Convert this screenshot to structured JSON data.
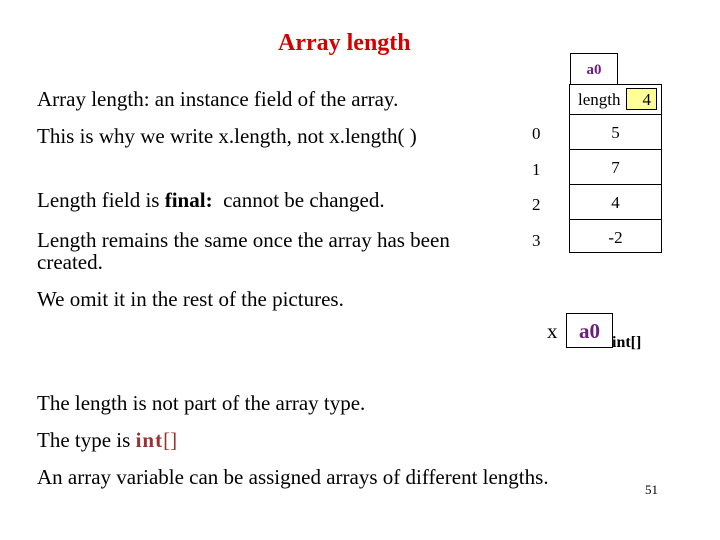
{
  "slide": {
    "title": "Array length",
    "page_number": "51",
    "colors": {
      "title": "#d40000",
      "object_name": "#6b1f7a",
      "length_box": "#ffff99",
      "type_highlight": "#993333"
    }
  },
  "text": {
    "line1": "Array length: an instance field of the array.",
    "line2": "This is why we write x.length, not x.length( )",
    "line3_prefix": "Length field is ",
    "line3_bold": "final:",
    "line3_suffix": "  cannot be changed.",
    "line4a": "Length remains the same once the array has been",
    "line4b": "created.",
    "line5": "We omit it in the rest of the pictures.",
    "line6": "The length is not part of the array type.",
    "line7_prefix": "The type is ",
    "line7_type": "int",
    "line7_brackets": "[]",
    "line8": "An array variable can be assigned arrays of different lengths."
  },
  "array_object": {
    "name": "a0",
    "length_label": "length",
    "length_value": "4",
    "elements": [
      {
        "index": "0",
        "value": "5"
      },
      {
        "index": "1",
        "value": "7"
      },
      {
        "index": "2",
        "value": "4"
      },
      {
        "index": "3",
        "value": "-2"
      }
    ]
  },
  "variable": {
    "name": "x",
    "value": "a0",
    "type": "int[]"
  }
}
